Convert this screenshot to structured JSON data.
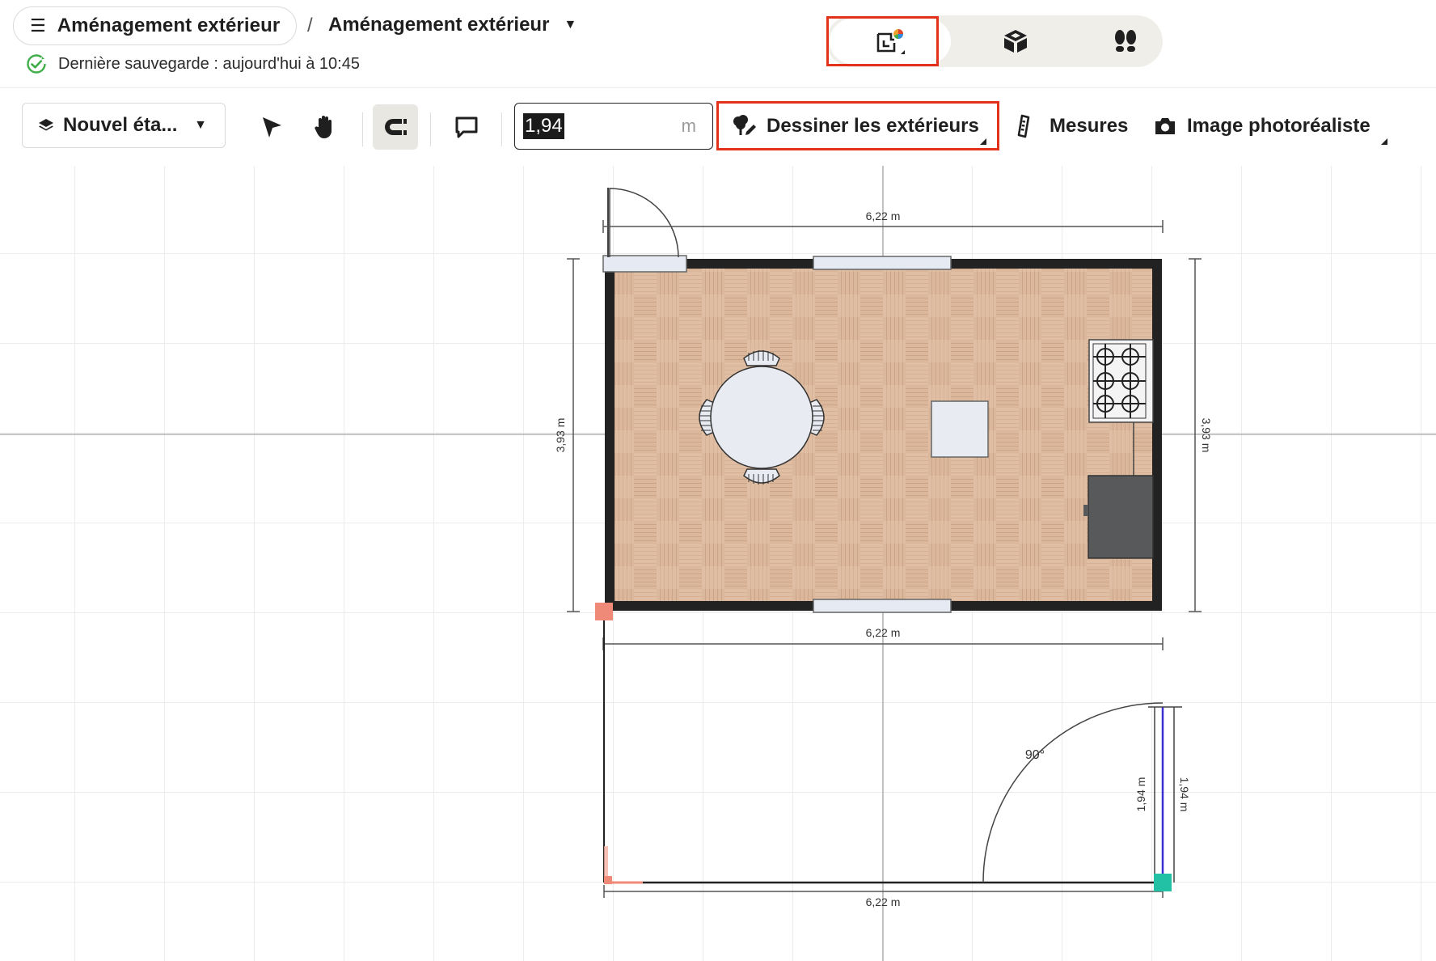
{
  "header": {
    "menu_icon": "hamburger-icon",
    "project_name": "Aménagement extérieur",
    "breadcrumb_separator": "/",
    "current_design": "Aménagement extérieur",
    "save_status": "Dernière sauvegarde : aujourd'hui à 10:45",
    "save_status_color": "#3fae49"
  },
  "view_toggle": {
    "options": [
      {
        "icon": "2d-floorplan-icon",
        "active": true
      },
      {
        "icon": "3d-cube-icon",
        "active": false
      },
      {
        "icon": "walkthrough-footsteps-icon",
        "active": false
      }
    ]
  },
  "toolbar": {
    "level_label": "Nouvel éta...",
    "tools": [
      "select-arrow-icon",
      "pan-hand-icon",
      "magnet-snap-icon",
      "comment-icon"
    ],
    "length_value": "1,94",
    "length_unit": "m",
    "draw_exteriors_label": "Dessiner les extérieurs",
    "measures_label": "Mesures",
    "photoreal_label": "Image photoréaliste"
  },
  "plan": {
    "room_top_width": "6,22 m",
    "room_bottom_width": "6,22 m",
    "room_left_height": "3,93 m",
    "room_right_height": "3,93 m",
    "terrace_bottom_width": "6,22 m",
    "segment_inner_length": "1,94 m",
    "segment_outer_length": "1,94 m",
    "angle": "90°",
    "floor_color": "#d8b59a",
    "wall_color": "#222222",
    "selected_segment_color": "#3a2fd0",
    "start_handle_color": "#f08a78",
    "end_handle_color": "#22c1a5"
  },
  "highlight_color": "#e2321b"
}
